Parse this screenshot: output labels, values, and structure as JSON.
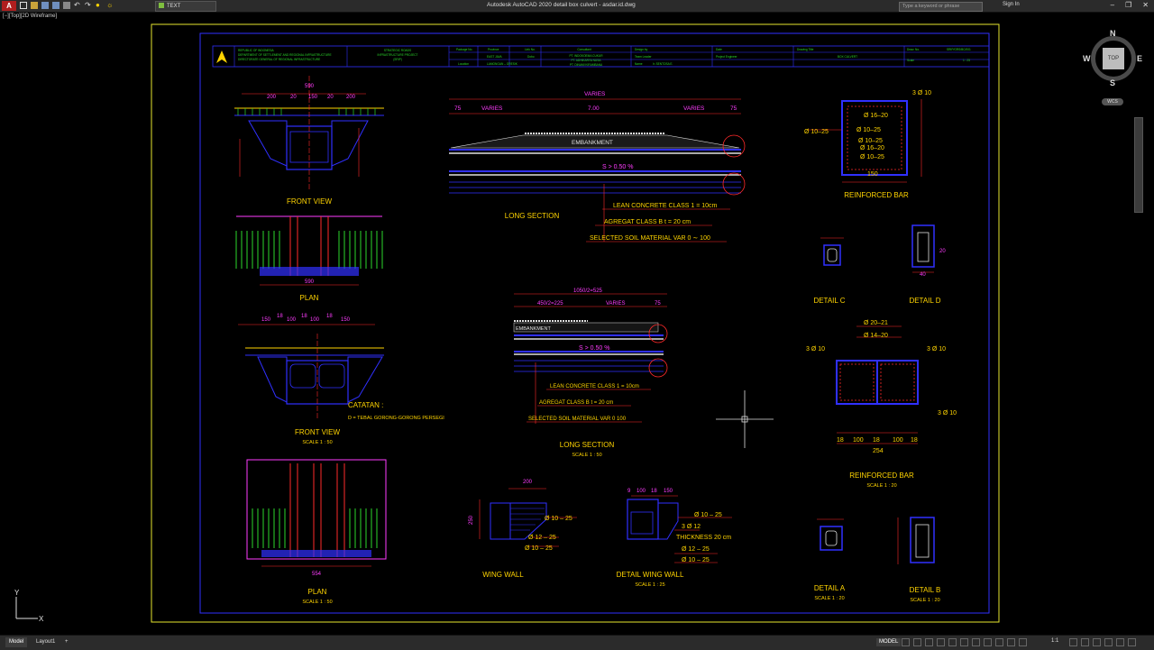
{
  "app": {
    "title": "Autodesk AutoCAD 2020    detail box culvert - asdar.id.dwg",
    "app_button": "A",
    "layer": "TEXT",
    "search_placeholder": "Type a keyword or phrase",
    "sign_in": "Sign In",
    "viewport_label": "[−][Top][2D Wireframe]"
  },
  "window_controls": [
    "–",
    "❐",
    "✕"
  ],
  "viewcube": {
    "top": "TOP",
    "n": "N",
    "s": "S",
    "e": "E",
    "w": "W",
    "wcs": "WCS"
  },
  "status": {
    "model_tab": "Model",
    "layout_tab": "Layout1",
    "add_tab": "+",
    "model_button": "MODEL",
    "scale": "1:1"
  },
  "ucs": {
    "x": "X",
    "y": "Y"
  },
  "colors": {
    "bg": "#000000",
    "border": "#e6e62e",
    "frame": "#3030ff",
    "red": "#ff2a2a",
    "magenta": "#ff3cff",
    "yellow": "#ffd400",
    "green": "#2bd82b",
    "white": "#e0e0e0"
  },
  "title_block": {
    "org": [
      "REPUBLIC OF INDONESIA",
      "DEPARTMENT OF SETTLEMENT AND REGIONAL INFRASTRUCTURE",
      "DIRECTORATE GENERAL OF REGIONAL INFRASTRUCTURE"
    ],
    "project": [
      "STRATEGIC ROADS",
      "INFRASTRUCTURE PROJECT",
      "(SRIP)"
    ],
    "h_package": "Package No.",
    "package": "EAST JAVA",
    "h_province": "Province",
    "province": "Dobo",
    "h_link": "Link No.",
    "h_location": "Location",
    "location": "LAMONGAN – GRESIK",
    "h_consultant": "Consultant",
    "consultant": [
      "PT. INDOKOEMA CUKUR",
      "PT. ADHIKARYA NUSA",
      "PT. DINAMI KIRAMBANA"
    ],
    "h_design": "Design by",
    "h_team": "Team Leader",
    "h_name": "Name",
    "name": "Ir. SENTOSA E.",
    "h_date": "Date",
    "h_drawing": "Drawing Title",
    "drawing_title": "BOX CULVERT",
    "h_engineer": "Project Engineer",
    "h_drw": "Draw. No.",
    "drw_no": "SRIP/GRS/BC/001",
    "h_scale": "Scale",
    "scale": "1 : 25"
  },
  "drawings": {
    "front_view": "FRONT VIEW",
    "plan": "PLAN",
    "long_section": "LONG SECTION",
    "reinforced_bar": "REINFORCED BAR",
    "reinforced_bar_typo": "REINFORCED BAR",
    "detail_c": "DETAIL C",
    "detail_d": "DETAIL D",
    "detail_a": "DETAIL A",
    "detail_b": "DETAIL B",
    "wing_wall": "WING WALL",
    "detail_wing_wall": "DETAIL WING WALL",
    "scale_50": "SCALE 1 : 50",
    "scale_25": "SCALE 1 : 25",
    "scale_20": "SCALE 1 : 20",
    "catatan": "CATATAN :",
    "catatan_note": "D = TEBAL GORONG-GORONG PERSEGI",
    "embankment": "EMBANKMENT",
    "slope": "S > 0.50 %",
    "lean_concrete": "LEAN CONCRETE CLASS 1 = 10cm",
    "agregat": "AGREGAT CLASS B  t  = 20 cm",
    "selected_soil": "SELECTED SOIL MATERIAL VAR 0 ∼ 100",
    "lean_concrete2": "LEAN CONCRETE CLASS 1 = 10cm",
    "agregat2": "AGREGAT CLASS B t = 20 cm",
    "selected_soil2": "SELECTED SOIL MATERIAL VAR 0    100",
    "varies": "VARIES",
    "dim_700": "7.00",
    "dim_75": "75",
    "dim_1050": "1050/2=525",
    "dim_450": "450/2=225",
    "fv_top": [
      "200",
      "20",
      "150",
      "20",
      "200"
    ],
    "fv_total": "590",
    "plan_total": "590",
    "plan2_total": "554",
    "fv2_top": [
      "150",
      "18",
      "100",
      "18",
      "100",
      "18",
      "150"
    ],
    "rb_labels": [
      "Ø 16–20",
      "Ø 10–25",
      "Ø 10–25",
      "Ø 16–20",
      "Ø 10–25",
      "3 Ø 10",
      "Ø 10–25"
    ],
    "rb_150": "150",
    "rb2_labels": [
      "Ø 20–21",
      "Ø 14–20",
      "3 Ø 10",
      "3 Ø 10",
      "3 Ø 10"
    ],
    "rb2_bottom": [
      "18",
      "100",
      "18",
      "100",
      "18"
    ],
    "rb2_total": "254",
    "ww_labels": [
      "Ø 10 – 25",
      "Ø 12 – 25",
      "Ø 10 – 25"
    ],
    "dww_labels": [
      "Ø 10 – 25",
      "3 Ø 12",
      "THICKNESS 20 cm",
      "Ø 12 – 25",
      "Ø 10 – 25"
    ],
    "dww_top": [
      "9",
      "100",
      "18",
      "150"
    ],
    "dim_200": "200",
    "dim_250": "250",
    "dim_40": "40",
    "dim_20": "20"
  }
}
